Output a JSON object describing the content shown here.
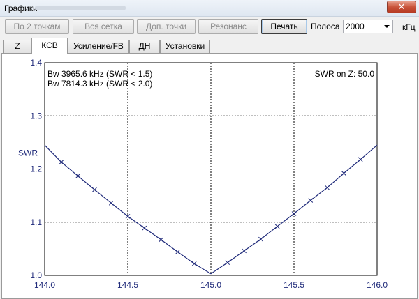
{
  "window": {
    "title": "Графики"
  },
  "toolbar": {
    "buttons": [
      "По 2 точкам",
      "Вся сетка",
      "Доп. точки",
      "Резонанс",
      "Печать"
    ],
    "band_label": "Полоса",
    "band_value": "2000",
    "unit": "кГц"
  },
  "tabs": [
    "Z",
    "КСВ",
    "Усиление/FB",
    "ДН",
    "Установки"
  ],
  "chart_data": {
    "type": "line",
    "ylabel": "SWR",
    "xlim": [
      144.0,
      146.0
    ],
    "ylim": [
      1.0,
      1.4
    ],
    "x_ticks": [
      "144.0",
      "144.5",
      "145.0",
      "145.5",
      "146.0"
    ],
    "y_ticks": [
      "1.0",
      "1.1",
      "1.2",
      "1.3",
      "1.4"
    ],
    "grid": true,
    "annotations": [
      "Bw 3965.6 kHz (SWR < 1.5)",
      "Bw 7814.3 kHz (SWR < 2.0)",
      "SWR on Z: 50.0"
    ],
    "series_color": "#1f2a7a",
    "series": [
      {
        "x": [
          144.0,
          144.1,
          144.2,
          144.3,
          144.4,
          144.5,
          144.6,
          144.7,
          144.8,
          144.9,
          145.0,
          145.1,
          145.2,
          145.3,
          145.4,
          145.5,
          145.6,
          145.7,
          145.8,
          145.9,
          146.0
        ],
        "values": [
          1.245,
          1.213,
          1.187,
          1.161,
          1.136,
          1.111,
          1.089,
          1.067,
          1.044,
          1.022,
          1.003,
          1.024,
          1.046,
          1.068,
          1.092,
          1.116,
          1.141,
          1.165,
          1.192,
          1.218,
          1.245
        ]
      }
    ]
  }
}
